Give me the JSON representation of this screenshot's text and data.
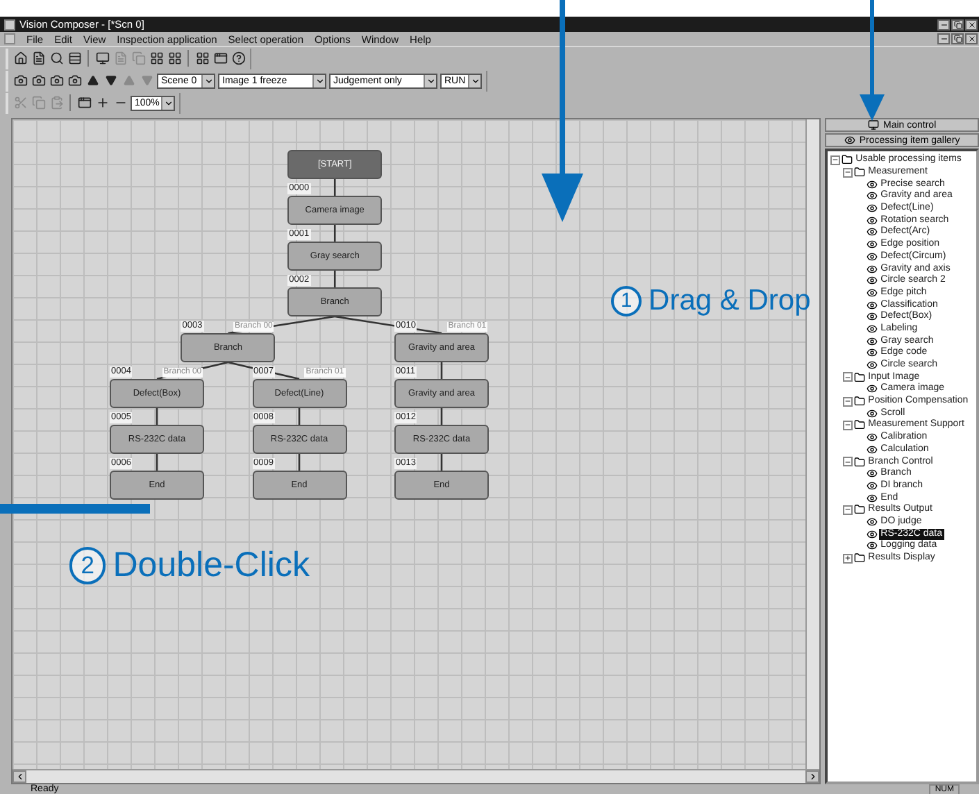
{
  "window": {
    "title": "Vision Composer - [*Scn 0]"
  },
  "menu": [
    "File",
    "Edit",
    "View",
    "Inspection application",
    "Select operation",
    "Options",
    "Window",
    "Help"
  ],
  "toolbar_2": {
    "scene": "Scene 0",
    "image": "Image 1 freeze",
    "display": "Judgement only",
    "mode": "RUN"
  },
  "toolbar_3": {
    "zoom": "100%"
  },
  "flow": {
    "label": "[START]",
    "kind": "start",
    "children": [
      {
        "number": "0000",
        "label": "Camera image",
        "kind": "step",
        "children": [
          {
            "number": "0001",
            "label": "Gray search",
            "kind": "step",
            "children": [
              {
                "number": "0002",
                "label": "Branch",
                "kind": "step",
                "children": [
                  {
                    "number": "0003",
                    "label": "Branch",
                    "kind": "step",
                    "branch_label": "Branch 00",
                    "children": [
                      {
                        "number": "0004",
                        "label": "Defect(Box)",
                        "kind": "step",
                        "branch_label": "Branch 00",
                        "children": [
                          {
                            "number": "0005",
                            "label": "RS-232C data",
                            "kind": "step",
                            "children": [
                              {
                                "number": "0006",
                                "label": "End",
                                "kind": "step"
                              }
                            ]
                          }
                        ]
                      },
                      {
                        "number": "0007",
                        "label": "Defect(Line)",
                        "kind": "step",
                        "branch_label": "Branch 01",
                        "children": [
                          {
                            "number": "0008",
                            "label": "RS-232C data",
                            "kind": "step",
                            "children": [
                              {
                                "number": "0009",
                                "label": "End",
                                "kind": "step"
                              }
                            ]
                          }
                        ]
                      }
                    ]
                  },
                  {
                    "number": "0010",
                    "label": "Gravity and area",
                    "kind": "step",
                    "branch_label": "Branch 01",
                    "children": [
                      {
                        "number": "0011",
                        "label": "Gravity and area",
                        "kind": "step",
                        "children": [
                          {
                            "number": "0012",
                            "label": "RS-232C data",
                            "kind": "step",
                            "children": [
                              {
                                "number": "0013",
                                "label": "End",
                                "kind": "step"
                              }
                            ]
                          }
                        ]
                      }
                    ]
                  }
                ]
              }
            ]
          }
        ]
      }
    ]
  },
  "panel": {
    "main_button": "Main control",
    "gallery_button": "Processing item gallery"
  },
  "gallery_tree": [
    {
      "label": "Usable processing items",
      "kind": "folder",
      "expanded": true,
      "selected": false,
      "children": [
        {
          "label": "Measurement",
          "kind": "folder",
          "expanded": true,
          "selected": false,
          "children": [
            {
              "label": "Precise search",
              "kind": "item",
              "selected": false
            },
            {
              "label": "Gravity and area",
              "kind": "item",
              "selected": false
            },
            {
              "label": "Defect(Line)",
              "kind": "item",
              "selected": false
            },
            {
              "label": "Rotation search",
              "kind": "item",
              "selected": false
            },
            {
              "label": "Defect(Arc)",
              "kind": "item",
              "selected": false
            },
            {
              "label": "Edge position",
              "kind": "item",
              "selected": false
            },
            {
              "label": "Defect(Circum)",
              "kind": "item",
              "selected": false
            },
            {
              "label": "Gravity and axis",
              "kind": "item",
              "selected": false
            },
            {
              "label": "Circle search 2",
              "kind": "item",
              "selected": false
            },
            {
              "label": "Edge pitch",
              "kind": "item",
              "selected": false
            },
            {
              "label": "Classification",
              "kind": "item",
              "selected": false
            },
            {
              "label": "Defect(Box)",
              "kind": "item",
              "selected": false
            },
            {
              "label": "Labeling",
              "kind": "item",
              "selected": false
            },
            {
              "label": "Gray search",
              "kind": "item",
              "selected": false
            },
            {
              "label": "Edge code",
              "kind": "item",
              "selected": false
            },
            {
              "label": "Circle search",
              "kind": "item",
              "selected": false
            }
          ]
        },
        {
          "label": "Input Image",
          "kind": "folder",
          "expanded": true,
          "selected": false,
          "children": [
            {
              "label": "Camera image",
              "kind": "item",
              "selected": false
            }
          ]
        },
        {
          "label": "Position Compensation",
          "kind": "folder",
          "expanded": true,
          "selected": false,
          "children": [
            {
              "label": "Scroll",
              "kind": "item",
              "selected": false
            }
          ]
        },
        {
          "label": "Measurement Support",
          "kind": "folder",
          "expanded": true,
          "selected": false,
          "children": [
            {
              "label": "Calibration",
              "kind": "item",
              "selected": false
            },
            {
              "label": "Calculation",
              "kind": "item",
              "selected": false
            }
          ]
        },
        {
          "label": "Branch Control",
          "kind": "folder",
          "expanded": true,
          "selected": false,
          "children": [
            {
              "label": "Branch",
              "kind": "item",
              "selected": false
            },
            {
              "label": "DI branch",
              "kind": "item",
              "selected": false
            },
            {
              "label": "End",
              "kind": "item",
              "selected": false
            }
          ]
        },
        {
          "label": "Results Output",
          "kind": "folder",
          "expanded": true,
          "selected": false,
          "children": [
            {
              "label": "DO judge",
              "kind": "item",
              "selected": false
            },
            {
              "label": "RS-232C data",
              "kind": "item",
              "selected": true
            },
            {
              "label": "Logging data",
              "kind": "item",
              "selected": false
            }
          ]
        },
        {
          "label": "Results Display",
          "kind": "folder",
          "expanded": false,
          "selected": false
        }
      ]
    }
  ],
  "status_bar": {
    "message": "Ready",
    "indicator": "NUM"
  },
  "annotations": [
    {
      "number": "1",
      "text": "Drag & Drop"
    },
    {
      "number": "2",
      "text": "Double-Click"
    }
  ]
}
